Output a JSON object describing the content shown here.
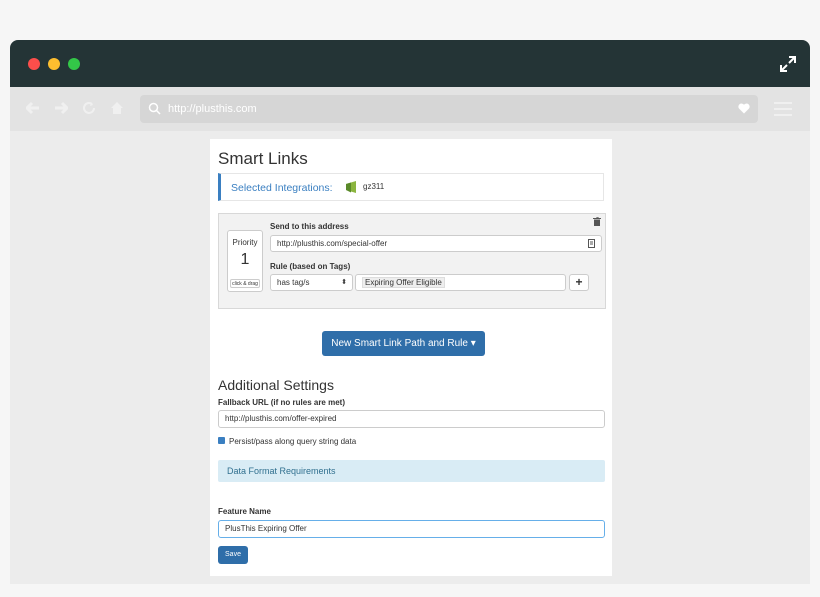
{
  "browser": {
    "url": "http://plusthis.com"
  },
  "page": {
    "title": "Smart Links",
    "integrations_label": "Selected Integrations:",
    "integration_name": "gz311"
  },
  "rule": {
    "priority_label": "Priority",
    "priority_value": "1",
    "drag_label": "click & drag",
    "send_label": "Send to this address",
    "send_value": "http://plusthis.com/special-offer",
    "rule_label": "Rule (based on Tags)",
    "condition_value": "has tag/s",
    "tag_value": "Expiring Offer Eligible",
    "add_label": "+"
  },
  "new_button_label": "New Smart Link Path and Rule ▾",
  "settings": {
    "title": "Additional Settings",
    "fallback_label": "Fallback URL (if no rules are met)",
    "fallback_value": "http://plusthis.com/offer-expired",
    "persist_label": "Persist/pass along query string data",
    "persist_checked": true,
    "data_format_label": "Data Format Requirements",
    "feature_name_label": "Feature Name",
    "feature_name_value": "PlusThis Expiring Offer",
    "save_label": "Save"
  },
  "icons": {
    "close": "red-dot",
    "minimize": "yellow-dot",
    "zoom": "green-dot",
    "expand": "expand-icon",
    "back": "back-arrow-icon",
    "forward": "forward-arrow-icon",
    "reload": "reload-icon",
    "home": "home-icon",
    "search": "search-icon",
    "favorite": "heart-icon",
    "menu": "hamburger-icon",
    "delete": "trash-icon",
    "note": "note-icon"
  },
  "colors": {
    "titlebar": "#243436",
    "accent": "#2f6ea9",
    "info_bg": "#d9ecf5"
  }
}
